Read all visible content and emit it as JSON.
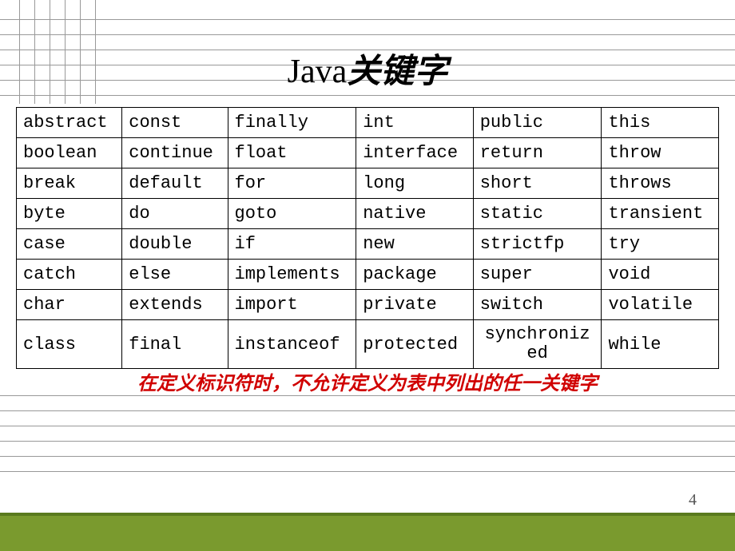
{
  "title": {
    "java": "Java",
    "cn": "关键字"
  },
  "table": [
    [
      "abstract",
      "const",
      "finally",
      "int",
      "public",
      "this"
    ],
    [
      "boolean",
      "continue",
      "float",
      "interface",
      "return",
      "throw"
    ],
    [
      "break",
      "default",
      "for",
      "long",
      "short",
      "throws"
    ],
    [
      "byte",
      "do",
      "goto",
      "native",
      "static",
      "transient"
    ],
    [
      "case",
      "double",
      "if",
      "new",
      "strictfp",
      "try"
    ],
    [
      "catch",
      "else",
      "implements",
      "package",
      "super",
      "void"
    ],
    [
      "char",
      "extends",
      "import",
      "private",
      "switch",
      "volatile"
    ],
    [
      "class",
      "final",
      "instanceof",
      "protected",
      "synchronized",
      "while"
    ]
  ],
  "note": "在定义标识符时，不允许定义为表中列出的任一关键字",
  "page_number": "4"
}
